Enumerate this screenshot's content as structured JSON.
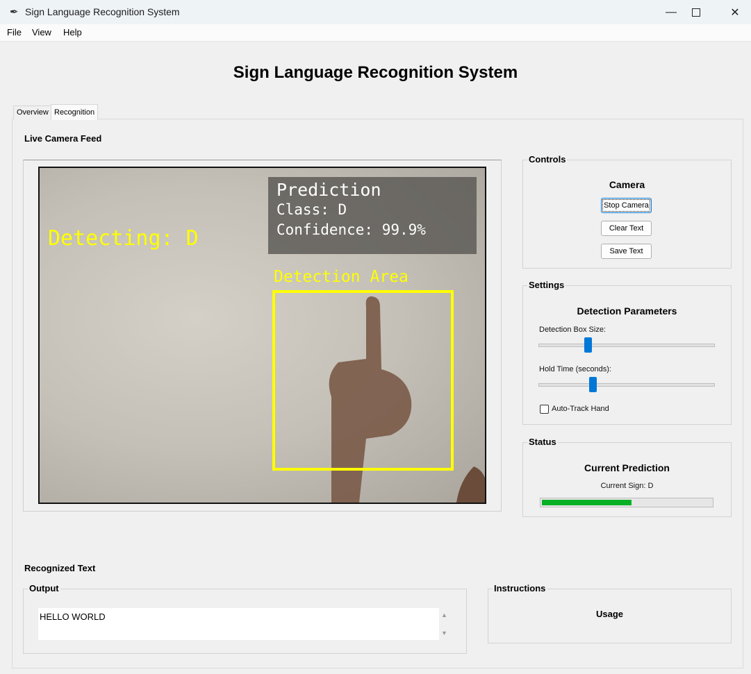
{
  "window": {
    "title": "Sign Language Recognition System",
    "icons": {
      "app": "feather-icon",
      "minimize": "minimize-icon",
      "maximize": "maximize-icon",
      "close": "close-icon"
    }
  },
  "menu": [
    "File",
    "View",
    "Help"
  ],
  "app_title": "Sign Language Recognition System",
  "tabs": [
    {
      "label": "Overview",
      "active": false
    },
    {
      "label": "Recognition",
      "active": true
    }
  ],
  "camera_section": {
    "label": "Live Camera Feed",
    "overlay": {
      "detecting": "Detecting: D",
      "prediction_title": "Prediction",
      "prediction_class": "Class: D",
      "prediction_confidence": "Confidence: 99.9%",
      "detection_area_label": "Detection Area",
      "overlay_color": "#ffff00"
    }
  },
  "controls": {
    "label": "Controls",
    "camera_heading": "Camera",
    "stop_camera": "Stop Camera",
    "clear_text": "Clear Text",
    "save_text": "Save Text"
  },
  "settings": {
    "label": "Settings",
    "heading": "Detection Parameters",
    "box_size_label": "Detection Box Size:",
    "box_size_level": 0.28,
    "hold_time_label": "Hold Time (seconds):",
    "hold_time_level": 0.31,
    "auto_track_label": "Auto-Track Hand",
    "auto_track_checked": false,
    "accent_color": "#0078d7"
  },
  "status": {
    "label": "Status",
    "heading": "Current Prediction",
    "current_sign": "Current Sign: D",
    "progress_level": 0.53,
    "progress_color": "#06b025"
  },
  "recognized": {
    "label": "Recognized Text",
    "output_label": "Output",
    "output_text": "HELLO WORLD"
  },
  "instructions": {
    "label": "Instructions",
    "heading": "Usage"
  }
}
